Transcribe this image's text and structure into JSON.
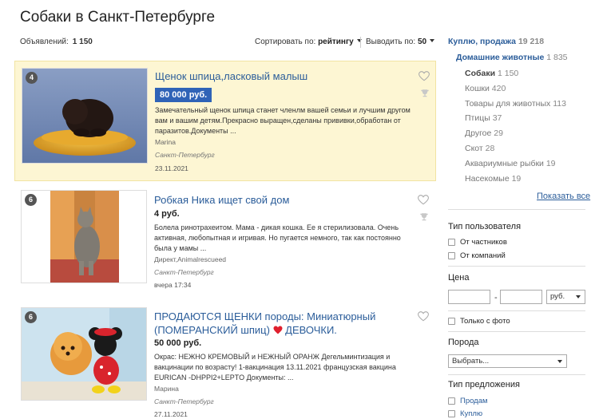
{
  "page": {
    "title": "Собаки в Санкт-Петербурге"
  },
  "stats": {
    "count_label": "Объявлений:",
    "count_value": "1 150",
    "sort_label": "Сортировать по:",
    "sort_value": "рейтингу",
    "perpage_label": "Выводить по:",
    "perpage_value": "50"
  },
  "listings": [
    {
      "badge": "4",
      "title": "Щенок шпица,ласковый малыш",
      "price": "80 000 руб.",
      "description": "Замечательный щенок шпица станет членлм вашей семьи и лучшим другом вам и вашим детям.Прекрасно выращен,сделаны прививки,обработан от паразитов.Документы ...",
      "seller": "Marina",
      "city": "Санкт-Петербург",
      "date": "23.11.2021"
    },
    {
      "badge": "6",
      "title": "Робкая Ника ищет свой дом",
      "price": "4 руб.",
      "description": "Болела ринотрахеитом. Мама - дикая кошка. Ее я стерилизовала. Очень активная, любопытная и игривая. Но пугается немного, так как постоянно была у мамы ...",
      "seller": "Директ,Animalrescueed",
      "city": "Санкт-Петербург",
      "date": "вчера 17:34"
    },
    {
      "badge": "6",
      "title": "ПРОДАЮТСЯ ЩЕНКИ породы: Миниатюрный (ПОМЕРАНСКИЙ шпиц)",
      "title_tail": "ДЕВОЧКИ.",
      "price": "50 000 руб.",
      "description": "Окрас: НЕЖНО КРЕМОВЫЙ и НЕЖНЫЙ ОРАНЖ Дегельминтизация и вакцинации по возрасту! 1-вакцинация 13.11.2021 французская вакцина EURICAN -DHPPI2+LEPTO Документы: ...",
      "seller": "Марина",
      "city": "Санкт-Петербург",
      "date": "27.11.2021"
    }
  ],
  "sidebar": {
    "categories": [
      {
        "name": "Куплю, продажа",
        "count": "19 218"
      },
      {
        "name": "Домашние животные",
        "count": "1 835"
      },
      {
        "name": "Собаки",
        "count": "1 150"
      },
      {
        "name": "Кошки",
        "count": "420"
      },
      {
        "name": "Товары для животных",
        "count": "113"
      },
      {
        "name": "Птицы",
        "count": "37"
      },
      {
        "name": "Другое",
        "count": "29"
      },
      {
        "name": "Скот",
        "count": "28"
      },
      {
        "name": "Аквариумные рыбки",
        "count": "19"
      },
      {
        "name": "Насекомые",
        "count": "19"
      }
    ],
    "show_all": "Показать все",
    "user_type": {
      "label": "Тип пользователя",
      "private": "От частников",
      "company": "От компаний"
    },
    "price": {
      "label": "Цена",
      "dash": "-",
      "currency": "руб."
    },
    "photo_only": "Только с фото",
    "breed": {
      "label": "Порода",
      "placeholder": "Выбрать..."
    },
    "offer_type": {
      "label": "Тип предложения",
      "sell": "Продам",
      "buy": "Куплю"
    }
  },
  "colors": {
    "link": "#2b5d9a",
    "price_box": "#2f63b7",
    "highlight": "#fdf6d3",
    "heart": "#e0202e"
  }
}
